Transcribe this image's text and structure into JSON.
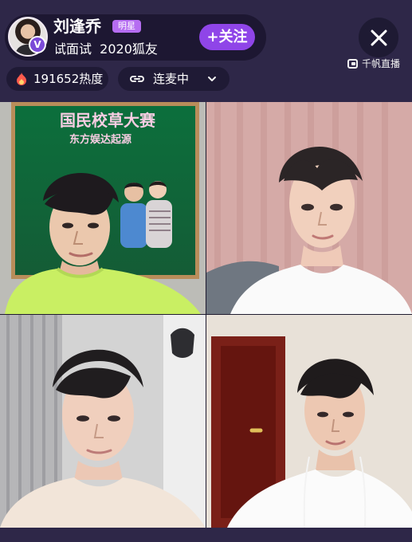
{
  "host": {
    "name": "刘逢乔",
    "tag": "明星",
    "vip_badge": "V",
    "ticker": "试面试  2020狐友"
  },
  "follow_label": "+关注",
  "platform_label": "千帆直播",
  "heat": {
    "value": "191652热度"
  },
  "connect": {
    "label": "连麦中"
  },
  "stream_tiles": [
    {
      "id": "top-left",
      "poster_headline": "国民校草大赛",
      "poster_subline": "东方娱达起源"
    },
    {
      "id": "top-right"
    },
    {
      "id": "bottom-left"
    },
    {
      "id": "bottom-right"
    }
  ],
  "colors": {
    "background": "#2e2748",
    "pill": "#1f1a35",
    "follow": "#8f45e8",
    "tag": "#b56df1",
    "fire": "#ff5b4d"
  },
  "icons": {
    "close": "close-icon",
    "fire": "fire-icon",
    "link": "link-icon",
    "chevron": "chevron-down-icon",
    "platform": "platform-logo-icon"
  }
}
